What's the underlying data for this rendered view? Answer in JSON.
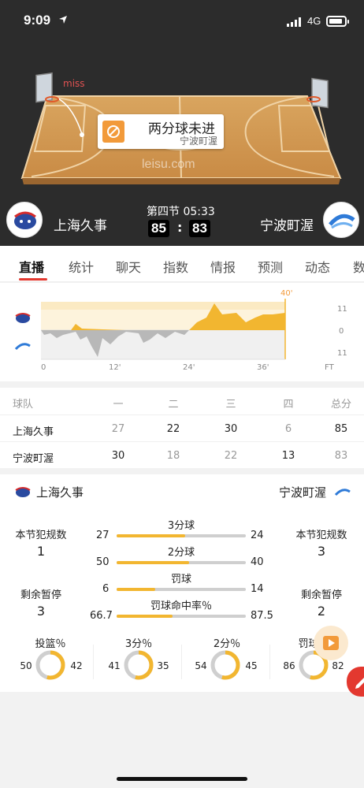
{
  "status": {
    "time": "9:09",
    "network": "4G"
  },
  "live": {
    "event_tag": "miss",
    "shot_title": "两分球未进",
    "shot_team": "宁波町渥",
    "watermark": "leisu.com"
  },
  "scoreboard": {
    "home_team": "上海久事",
    "away_team": "宁波町渥",
    "period": "第四节",
    "clock": "05:33",
    "home_score": "85",
    "colon": ":",
    "away_score": "83"
  },
  "tabs": [
    "直播",
    "统计",
    "聊天",
    "指数",
    "情报",
    "预测",
    "动态",
    "数"
  ],
  "trend": {
    "marker": "40'",
    "y_labels": [
      "11",
      "0",
      "11"
    ],
    "x_labels": [
      "0",
      "12'",
      "24'",
      "36'",
      "FT"
    ]
  },
  "quarters": {
    "header": [
      "球队",
      "一",
      "二",
      "三",
      "四",
      "总分"
    ],
    "rows": [
      {
        "team": "上海久事",
        "q1": "27",
        "q2": "22",
        "q3": "30",
        "q4": "6",
        "total": "85"
      },
      {
        "team": "宁波町渥",
        "q1": "30",
        "q2": "18",
        "q3": "22",
        "q4": "13",
        "total": "83"
      }
    ]
  },
  "stats": {
    "home_team": "上海久事",
    "away_team": "宁波町渥",
    "fouls_label": "本节犯规数",
    "home_fouls": "1",
    "away_fouls": "3",
    "timeouts_label": "剩余暂停",
    "home_timeouts": "3",
    "away_timeouts": "2",
    "bars": [
      {
        "title": "3分球",
        "home": "27",
        "away": "24",
        "home_share": 0.53
      },
      {
        "title": "2分球",
        "home": "50",
        "away": "40",
        "home_share": 0.56
      },
      {
        "title": "罚球",
        "home": "6",
        "away": "14",
        "home_share": 0.3
      },
      {
        "title": "罚球命中率％",
        "home": "66.7",
        "away": "87.5",
        "home_share": 0.43
      }
    ],
    "donuts": [
      {
        "title": "投篮％",
        "home": "50",
        "away": "42"
      },
      {
        "title": "3分％",
        "home": "41",
        "away": "35"
      },
      {
        "title": "2分％",
        "home": "54",
        "away": "45"
      },
      {
        "title": "罚球％",
        "home": "86",
        "away": "82"
      }
    ]
  },
  "colors": {
    "accent": "#e3382f",
    "bar": "#f2b630",
    "dark_bg": "#2c2c2c"
  }
}
